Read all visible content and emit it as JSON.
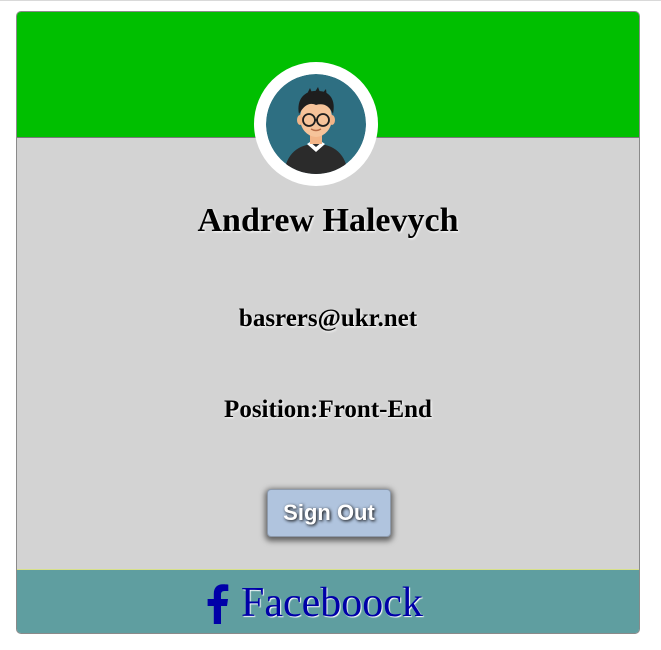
{
  "profile": {
    "name": "Andrew Halevych",
    "email": "basrers@ukr.net",
    "position_label": "Position:",
    "position_value": "Front-End",
    "avatar_icon": "user-avatar-glasses-icon"
  },
  "actions": {
    "sign_out_label": "Sign Out"
  },
  "footer": {
    "link_icon": "facebook-f-icon",
    "link_label": "Faceboock"
  },
  "colors": {
    "header": "#00bf00",
    "body": "#d3d3d3",
    "footer": "#5f9ea0",
    "button": "#b0c4de",
    "link": "#0000a8"
  }
}
